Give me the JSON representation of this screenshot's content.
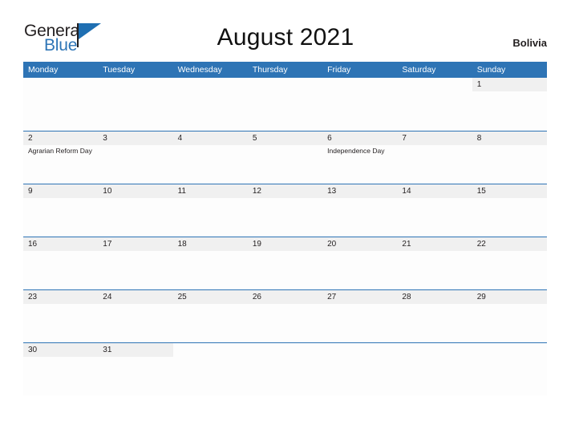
{
  "brand": {
    "name_part1": "General",
    "name_part2": "Blue",
    "flag_icon": "flag-triangle-icon"
  },
  "header": {
    "title": "August 2021",
    "country": "Bolivia"
  },
  "colors": {
    "header_blue": "#2e74b5",
    "band_gray": "#f0f0f0",
    "brand_blue": "#2e75b6",
    "text_dark": "#231f20"
  },
  "calendar": {
    "weekday_headers": [
      "Monday",
      "Tuesday",
      "Wednesday",
      "Thursday",
      "Friday",
      "Saturday",
      "Sunday"
    ],
    "weeks": [
      [
        {
          "date": "",
          "blank": true,
          "events": []
        },
        {
          "date": "",
          "blank": true,
          "events": []
        },
        {
          "date": "",
          "blank": true,
          "events": []
        },
        {
          "date": "",
          "blank": true,
          "events": []
        },
        {
          "date": "",
          "blank": true,
          "events": []
        },
        {
          "date": "",
          "blank": true,
          "events": []
        },
        {
          "date": "1",
          "blank": false,
          "events": []
        }
      ],
      [
        {
          "date": "2",
          "blank": false,
          "events": [
            "Agrarian Reform Day"
          ]
        },
        {
          "date": "3",
          "blank": false,
          "events": []
        },
        {
          "date": "4",
          "blank": false,
          "events": []
        },
        {
          "date": "5",
          "blank": false,
          "events": []
        },
        {
          "date": "6",
          "blank": false,
          "events": [
            "Independence Day"
          ]
        },
        {
          "date": "7",
          "blank": false,
          "events": []
        },
        {
          "date": "8",
          "blank": false,
          "events": []
        }
      ],
      [
        {
          "date": "9",
          "blank": false,
          "events": []
        },
        {
          "date": "10",
          "blank": false,
          "events": []
        },
        {
          "date": "11",
          "blank": false,
          "events": []
        },
        {
          "date": "12",
          "blank": false,
          "events": []
        },
        {
          "date": "13",
          "blank": false,
          "events": []
        },
        {
          "date": "14",
          "blank": false,
          "events": []
        },
        {
          "date": "15",
          "blank": false,
          "events": []
        }
      ],
      [
        {
          "date": "16",
          "blank": false,
          "events": []
        },
        {
          "date": "17",
          "blank": false,
          "events": []
        },
        {
          "date": "18",
          "blank": false,
          "events": []
        },
        {
          "date": "19",
          "blank": false,
          "events": []
        },
        {
          "date": "20",
          "blank": false,
          "events": []
        },
        {
          "date": "21",
          "blank": false,
          "events": []
        },
        {
          "date": "22",
          "blank": false,
          "events": []
        }
      ],
      [
        {
          "date": "23",
          "blank": false,
          "events": []
        },
        {
          "date": "24",
          "blank": false,
          "events": []
        },
        {
          "date": "25",
          "blank": false,
          "events": []
        },
        {
          "date": "26",
          "blank": false,
          "events": []
        },
        {
          "date": "27",
          "blank": false,
          "events": []
        },
        {
          "date": "28",
          "blank": false,
          "events": []
        },
        {
          "date": "29",
          "blank": false,
          "events": []
        }
      ],
      [
        {
          "date": "30",
          "blank": false,
          "events": []
        },
        {
          "date": "31",
          "blank": false,
          "events": []
        },
        {
          "date": "",
          "blank": true,
          "events": []
        },
        {
          "date": "",
          "blank": true,
          "events": []
        },
        {
          "date": "",
          "blank": true,
          "events": []
        },
        {
          "date": "",
          "blank": true,
          "events": []
        },
        {
          "date": "",
          "blank": true,
          "events": []
        }
      ]
    ]
  }
}
